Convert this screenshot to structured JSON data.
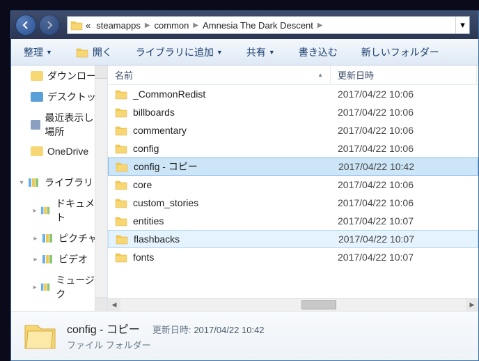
{
  "breadcrumbs": {
    "prefix": "«",
    "items": [
      "steamapps",
      "common",
      "Amnesia The Dark Descent"
    ]
  },
  "toolbar": {
    "organize": "整理",
    "open": "開く",
    "addlib": "ライブラリに追加",
    "share": "共有",
    "burn": "書き込む",
    "newfolder": "新しいフォルダー"
  },
  "sidebar": {
    "items": [
      {
        "icon": "download",
        "label": "ダウンロード"
      },
      {
        "icon": "desktop",
        "label": "デスクトップ"
      },
      {
        "icon": "recent",
        "label": "最近表示した場所"
      },
      {
        "icon": "onedrive",
        "label": "OneDrive"
      }
    ],
    "library": {
      "header": "ライブラリ",
      "items": [
        "ドキュメント",
        "ピクチャ",
        "ビデオ",
        "ミュージック"
      ]
    }
  },
  "columns": {
    "name": "名前",
    "modified": "更新日時"
  },
  "files": [
    {
      "name": "_CommonRedist",
      "date": "2017/04/22 10:06"
    },
    {
      "name": "billboards",
      "date": "2017/04/22 10:06"
    },
    {
      "name": "commentary",
      "date": "2017/04/22 10:06"
    },
    {
      "name": "config",
      "date": "2017/04/22 10:06"
    },
    {
      "name": "config - コピー",
      "date": "2017/04/22 10:42",
      "selected": true
    },
    {
      "name": "core",
      "date": "2017/04/22 10:06"
    },
    {
      "name": "custom_stories",
      "date": "2017/04/22 10:06"
    },
    {
      "name": "entities",
      "date": "2017/04/22 10:07"
    },
    {
      "name": "flashbacks",
      "date": "2017/04/22 10:07",
      "hover": true
    },
    {
      "name": "fonts",
      "date": "2017/04/22 10:07"
    }
  ],
  "details": {
    "name": "config - コピー",
    "modified_label": "更新日時:",
    "modified": "2017/04/22 10:42",
    "type": "ファイル フォルダー"
  }
}
